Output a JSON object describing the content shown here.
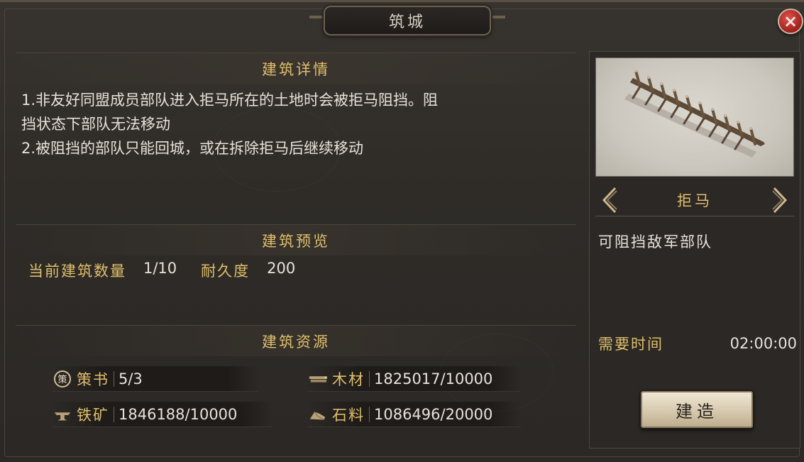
{
  "window": {
    "title": "筑城",
    "close_label": "×"
  },
  "details": {
    "heading": "建筑详情",
    "lines": [
      "1.非友好同盟成员部队进入拒马所在的土地时会被拒马阻挡。阻",
      "挡状态下部队无法移动",
      "2.被阻挡的部队只能回城，或在拆除拒马后继续移动"
    ]
  },
  "preview": {
    "heading": "建筑预览",
    "count_label": "当前建筑数量",
    "count_value": "1/10",
    "durability_label": "耐久度",
    "durability_value": "200"
  },
  "resources": {
    "heading": "建筑资源",
    "items": [
      {
        "name": "策书",
        "value": "5/3",
        "icon": "strategy-book-icon"
      },
      {
        "name": "木材",
        "value": "1825017/10000",
        "icon": "wood-icon"
      },
      {
        "name": "铁矿",
        "value": "1846188/10000",
        "icon": "iron-ore-icon"
      },
      {
        "name": "石料",
        "value": "1086496/20000",
        "icon": "stone-icon"
      }
    ],
    "book_icon_glyph": "策"
  },
  "building": {
    "name": "拒马",
    "description": "可阻挡敌军部队",
    "time_label": "需要时间",
    "time_value": "02:00:00",
    "build_label": "建造"
  },
  "colors": {
    "gold_text": "#e0bf6c",
    "body_text": "#e7e2da",
    "close_red": "#c0302a"
  }
}
